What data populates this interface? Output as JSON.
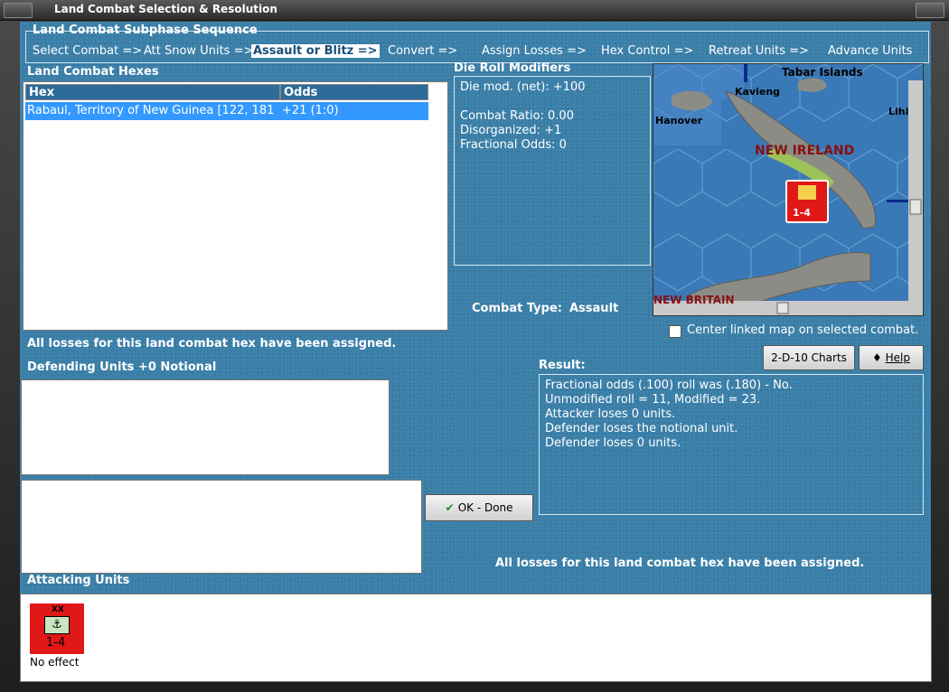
{
  "window": {
    "title": "Land Combat Selection & Resolution"
  },
  "sequence": {
    "title": "Land Combat Subphase Sequence",
    "steps": [
      "Select Combat =>",
      "Att Snow Units =>",
      "Assault or Blitz =>",
      "Convert =>",
      "Assign Losses =>",
      "Hex Control =>",
      "Retreat Units =>",
      "Advance Units"
    ]
  },
  "hexes": {
    "title": "Land Combat Hexes",
    "columns": [
      "Hex",
      "Odds"
    ],
    "rows": [
      {
        "hex": "Rabaul, Territory of New Guinea [122, 181",
        "odds": "+21 (1:0)"
      }
    ],
    "status": "All losses for this land combat hex have been assigned."
  },
  "modifiers": {
    "title": "Die Roll Modifiers",
    "lines": [
      "Die mod. (net): +100",
      "",
      "Combat Ratio: 0.00",
      "Disorganized: +1",
      "Fractional Odds: 0"
    ],
    "combat_type_label": "Combat Type:",
    "combat_type": "Assault"
  },
  "map": {
    "labels": {
      "tabar": "Tabar Islands",
      "kavieng": "Kavieng",
      "hanover": "Hanover",
      "lihir": "Lihi",
      "new_ireland": "NEW IRELAND",
      "new_britain": "NEW BRITAIN"
    },
    "counter_value": "1-4",
    "center_checkbox_label": "Center linked map on selected combat.",
    "center_checked": false
  },
  "buttons": {
    "charts": "2-D-10 Charts",
    "help": "Help",
    "ok": "OK - Done"
  },
  "defending": {
    "title": "Defending Units +0 Notional"
  },
  "result": {
    "title": "Result:",
    "lines": [
      "Fractional odds (.100) roll was (.180)  - No.",
      "Unmodified roll = 11, Modified = 23.",
      "Attacker loses 0 units.",
      "Defender loses the notional unit.",
      "Defender loses 0 units."
    ],
    "status": "All losses for this land combat hex have been assigned."
  },
  "attacking": {
    "title": "Attacking Units",
    "unit": {
      "size": "XX",
      "strength": "1-4",
      "outcome": "No effect"
    }
  },
  "colors": {
    "panel": "#3a7fa8",
    "selected_row": "#3399ff",
    "unit_red": "#e01818"
  }
}
